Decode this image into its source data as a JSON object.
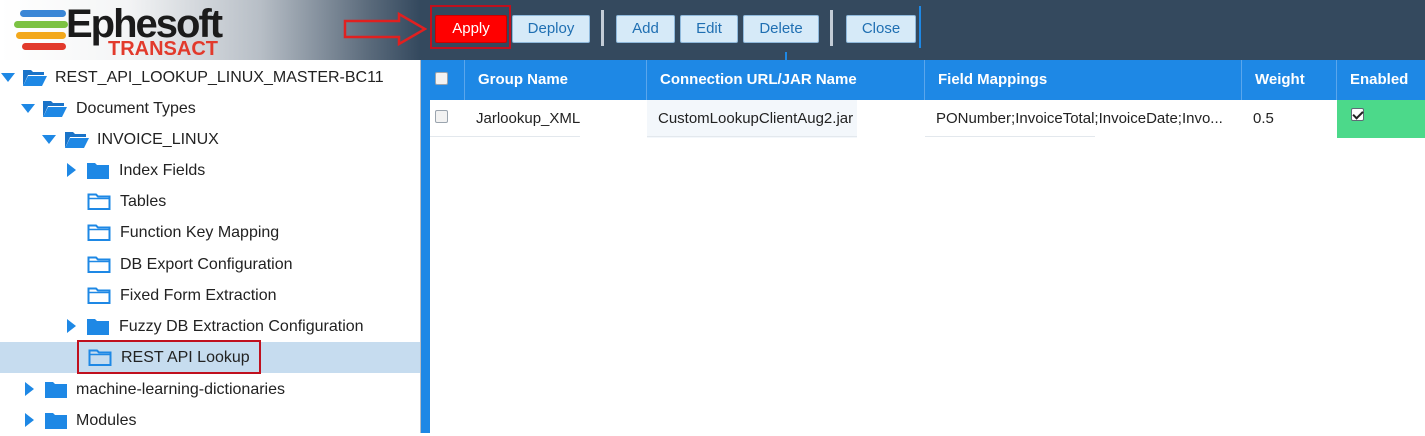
{
  "logo": {
    "name": "Ephesoft",
    "sub": "TRANSACT",
    "bar_colors": [
      "#3a86d6",
      "#7cc243",
      "#f3a81c",
      "#e23a2c"
    ]
  },
  "toolbar": {
    "apply": "Apply",
    "deploy": "Deploy",
    "add": "Add",
    "edit": "Edit",
    "delete": "Delete",
    "close": "Close"
  },
  "tree": {
    "root": "REST_API_LOOKUP_LINUX_MASTER-BC11",
    "document_types": "Document Types",
    "invoice": "INVOICE_LINUX",
    "index_fields": "Index Fields",
    "tables": "Tables",
    "function_key_mapping": "Function Key Mapping",
    "db_export": "DB Export Configuration",
    "fixed_form": "Fixed Form Extraction",
    "fuzzy_db": "Fuzzy DB Extraction Configuration",
    "rest_api": "REST API Lookup",
    "ml_dictionaries": "machine-learning-dictionaries",
    "modules": "Modules"
  },
  "grid": {
    "headers": {
      "group_name": "Group Name",
      "connection": "Connection URL/JAR Name",
      "field_mappings": "Field Mappings",
      "weight": "Weight",
      "enabled": "Enabled"
    },
    "rows": [
      {
        "selected": false,
        "group_name": "Jarlookup_XML",
        "connection": "CustomLookupClientAug2.jar",
        "field_mappings": "PONumber;InvoiceTotal;InvoiceDate;Invo...",
        "weight": "0.5",
        "enabled": true
      }
    ]
  },
  "colors": {
    "header_bg": "#34495e",
    "accent": "#1e88e5",
    "apply_red": "#ff0000",
    "highlight_red": "#c0101e",
    "enabled_green": "#4cd98a",
    "selected_row": "#c6dcef"
  }
}
